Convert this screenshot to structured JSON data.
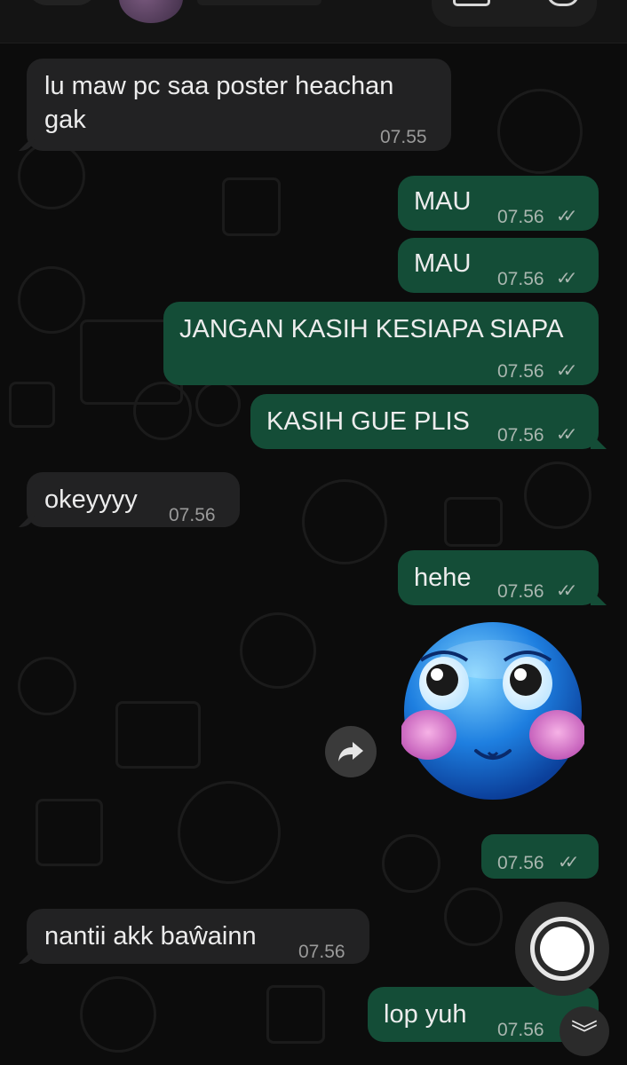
{
  "messages": [
    {
      "id": "m1",
      "dir": "in",
      "text": "lu maw pc saa poster heachan gak",
      "time": "07.55"
    },
    {
      "id": "m2",
      "dir": "out",
      "text": "MAU",
      "time": "07.56"
    },
    {
      "id": "m3",
      "dir": "out",
      "text": "MAU",
      "time": "07.56"
    },
    {
      "id": "m4",
      "dir": "out",
      "text": "JANGAN KASIH KESIAPA SIAPA",
      "time": "07.56"
    },
    {
      "id": "m5",
      "dir": "out",
      "text": "KASIH GUE PLIS",
      "time": "07.56"
    },
    {
      "id": "m6",
      "dir": "in",
      "text": "okeyyyy",
      "time": "07.56"
    },
    {
      "id": "m7",
      "dir": "out",
      "text": "hehe",
      "time": "07.56"
    },
    {
      "id": "m8",
      "dir": "out",
      "sticker": "blushing-blue-smiley-sticker",
      "time": "07.56"
    },
    {
      "id": "m9",
      "dir": "in",
      "text": "nantii akk baŵainn",
      "time": "07.56"
    },
    {
      "id": "m10",
      "dir": "out",
      "text": "lop yuh",
      "time": "07.56"
    }
  ],
  "read_ticks": "✓✓",
  "icons": {
    "forward": "forward-arrow-icon",
    "camera": "camera-shutter-icon",
    "scroll_down": "double-chevron-down-icon",
    "scroll_down_glyph": "︾"
  },
  "colors": {
    "incoming_bubble": "#222223",
    "outgoing_bubble": "#144d37",
    "background": "#0c0c0c"
  }
}
